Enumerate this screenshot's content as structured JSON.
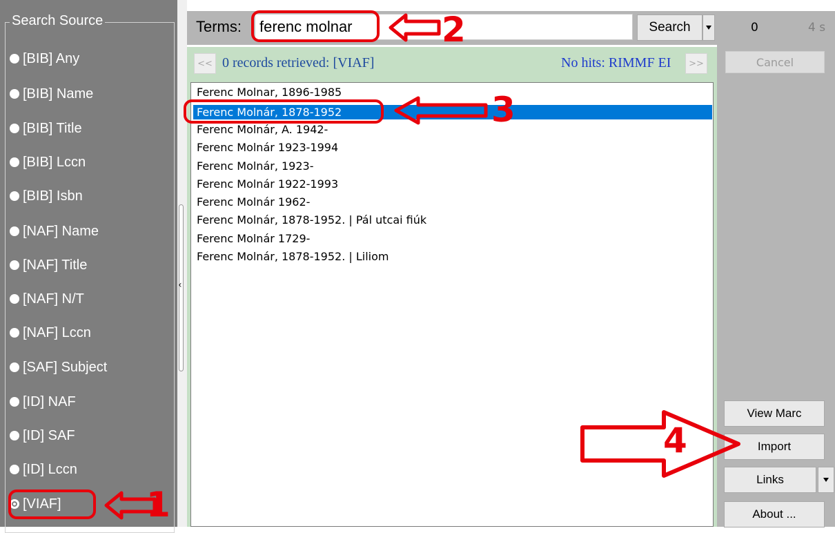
{
  "search_source": {
    "legend": "Search Source",
    "options": [
      {
        "label": "[BIB] Any",
        "selected": false
      },
      {
        "label": "[BIB] Name",
        "selected": false
      },
      {
        "label": "[BIB] Title",
        "selected": false
      },
      {
        "label": "[BIB] Lccn",
        "selected": false
      },
      {
        "label": "[BIB] Isbn",
        "selected": false
      },
      {
        "label": "[NAF] Name",
        "selected": false
      },
      {
        "label": "[NAF] Title",
        "selected": false
      },
      {
        "label": "[NAF] N/T",
        "selected": false
      },
      {
        "label": "[NAF] Lccn",
        "selected": false
      },
      {
        "label": "[SAF] Subject",
        "selected": false
      },
      {
        "label": "[ID] NAF",
        "selected": false
      },
      {
        "label": "[ID] SAF",
        "selected": false
      },
      {
        "label": "[ID] Lccn",
        "selected": false
      },
      {
        "label": "[VIAF]",
        "selected": true
      }
    ]
  },
  "search_bar": {
    "terms_label": "Terms:",
    "terms_value": "ferenc molnar",
    "search_button": "Search"
  },
  "status": {
    "prev_label": "<<",
    "next_label": ">>",
    "records_text": "0 records retrieved: [VIAF]",
    "no_hits_text": "No hits: RIMMF EI"
  },
  "results": [
    {
      "text": "Ferenc Molnar, 1896-1985",
      "selected": false
    },
    {
      "text": "Ferenc Molnár, 1878-1952",
      "selected": true
    },
    {
      "text": "Ferenc Molnár, A. 1942-",
      "selected": false
    },
    {
      "text": "Ferenc Molnár 1923-1994",
      "selected": false
    },
    {
      "text": "Ferenc Molnár, 1923-",
      "selected": false
    },
    {
      "text": "Ferenc Molnár 1922-1993",
      "selected": false
    },
    {
      "text": "Ferenc Molnár 1962-",
      "selected": false
    },
    {
      "text": "Ferenc Molnár, 1878-1952. | Pál utcai fiúk",
      "selected": false
    },
    {
      "text": "Ferenc Molnár 1729-",
      "selected": false
    },
    {
      "text": "Ferenc Molnár, 1878-1952. | Liliom",
      "selected": false
    }
  ],
  "right_panel": {
    "count": "0",
    "time": "4 s",
    "cancel": "Cancel",
    "view_marc": "View Marc",
    "import": "Import",
    "links": "Links",
    "about": "About ..."
  },
  "annotations": {
    "step1": "1",
    "step2": "2",
    "step3": "3",
    "step4": "4",
    "color": "#e8000b"
  },
  "colors": {
    "panel_gray": "#7e7e7e",
    "status_green": "#c5dfc5",
    "selection_blue": "#0078d7",
    "link_blue": "#1f3ccc"
  }
}
